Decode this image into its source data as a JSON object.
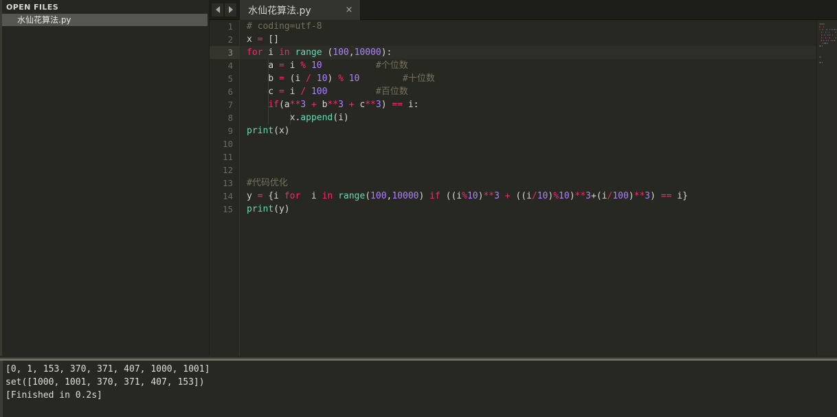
{
  "sidebar": {
    "header": "OPEN FILES",
    "items": [
      {
        "label": "水仙花算法.py",
        "selected": true
      }
    ]
  },
  "tabbar": {
    "nav_prev_icon": "triangle-left-icon",
    "nav_next_icon": "triangle-right-icon",
    "tabs": [
      {
        "label": "水仙花算法.py",
        "close_label": "×",
        "active": true
      }
    ]
  },
  "editor": {
    "active_line": 3,
    "line_numbers": [
      "1",
      "2",
      "3",
      "4",
      "5",
      "6",
      "7",
      "8",
      "9",
      "10",
      "11",
      "12",
      "13",
      "14",
      "15"
    ],
    "lines": [
      {
        "n": 1,
        "tokens": [
          {
            "t": "# coding=utf-8",
            "c": "t-comment"
          }
        ]
      },
      {
        "n": 2,
        "tokens": [
          {
            "t": "x ",
            "c": "t-ident"
          },
          {
            "t": "=",
            "c": "t-op"
          },
          {
            "t": " []",
            "c": "t-punct"
          }
        ]
      },
      {
        "n": 3,
        "tokens": [
          {
            "t": "for",
            "c": "t-keyword"
          },
          {
            "t": " i ",
            "c": "t-ident"
          },
          {
            "t": "in",
            "c": "t-keyword"
          },
          {
            "t": " ",
            "c": "t-plain"
          },
          {
            "t": "range",
            "c": "t-func"
          },
          {
            "t": " (",
            "c": "t-punct"
          },
          {
            "t": "100",
            "c": "t-number"
          },
          {
            "t": ",",
            "c": "t-punct"
          },
          {
            "t": "10000",
            "c": "t-number"
          },
          {
            "t": "):",
            "c": "t-punct"
          }
        ]
      },
      {
        "n": 4,
        "tokens": [
          {
            "t": "    a ",
            "c": "t-ident"
          },
          {
            "t": "=",
            "c": "t-op"
          },
          {
            "t": " i ",
            "c": "t-ident"
          },
          {
            "t": "%",
            "c": "t-op"
          },
          {
            "t": " ",
            "c": "t-plain"
          },
          {
            "t": "10",
            "c": "t-number"
          },
          {
            "t": "          ",
            "c": "t-plain"
          },
          {
            "t": "#个位数",
            "c": "t-comment"
          }
        ]
      },
      {
        "n": 5,
        "tokens": [
          {
            "t": "    b ",
            "c": "t-ident"
          },
          {
            "t": "=",
            "c": "t-op"
          },
          {
            "t": " (i ",
            "c": "t-punct"
          },
          {
            "t": "/",
            "c": "t-op"
          },
          {
            "t": " ",
            "c": "t-plain"
          },
          {
            "t": "10",
            "c": "t-number"
          },
          {
            "t": ") ",
            "c": "t-punct"
          },
          {
            "t": "%",
            "c": "t-op"
          },
          {
            "t": " ",
            "c": "t-plain"
          },
          {
            "t": "10",
            "c": "t-number"
          },
          {
            "t": "        ",
            "c": "t-plain"
          },
          {
            "t": "#十位数",
            "c": "t-comment"
          }
        ]
      },
      {
        "n": 6,
        "tokens": [
          {
            "t": "    c ",
            "c": "t-ident"
          },
          {
            "t": "=",
            "c": "t-op"
          },
          {
            "t": " i ",
            "c": "t-ident"
          },
          {
            "t": "/",
            "c": "t-op"
          },
          {
            "t": " ",
            "c": "t-plain"
          },
          {
            "t": "100",
            "c": "t-number"
          },
          {
            "t": "         ",
            "c": "t-plain"
          },
          {
            "t": "#百位数",
            "c": "t-comment"
          }
        ]
      },
      {
        "n": 7,
        "tokens": [
          {
            "t": "    ",
            "c": "t-plain"
          },
          {
            "t": "if",
            "c": "t-keyword"
          },
          {
            "t": "(a",
            "c": "t-punct"
          },
          {
            "t": "**",
            "c": "t-op"
          },
          {
            "t": "3",
            "c": "t-number"
          },
          {
            "t": " ",
            "c": "t-plain"
          },
          {
            "t": "+",
            "c": "t-op"
          },
          {
            "t": " b",
            "c": "t-ident"
          },
          {
            "t": "**",
            "c": "t-op"
          },
          {
            "t": "3",
            "c": "t-number"
          },
          {
            "t": " ",
            "c": "t-plain"
          },
          {
            "t": "+",
            "c": "t-op"
          },
          {
            "t": " c",
            "c": "t-ident"
          },
          {
            "t": "**",
            "c": "t-op"
          },
          {
            "t": "3",
            "c": "t-number"
          },
          {
            "t": ") ",
            "c": "t-punct"
          },
          {
            "t": "==",
            "c": "t-op"
          },
          {
            "t": " i:",
            "c": "t-punct"
          }
        ]
      },
      {
        "n": 8,
        "tokens": [
          {
            "t": "        x.",
            "c": "t-punct"
          },
          {
            "t": "append",
            "c": "t-func"
          },
          {
            "t": "(i)",
            "c": "t-punct"
          }
        ]
      },
      {
        "n": 9,
        "tokens": [
          {
            "t": "print",
            "c": "t-func"
          },
          {
            "t": "(x)",
            "c": "t-punct"
          }
        ]
      },
      {
        "n": 10,
        "tokens": []
      },
      {
        "n": 11,
        "tokens": []
      },
      {
        "n": 12,
        "tokens": []
      },
      {
        "n": 13,
        "tokens": [
          {
            "t": "#代码优化",
            "c": "t-comment"
          }
        ]
      },
      {
        "n": 14,
        "tokens": [
          {
            "t": "y ",
            "c": "t-ident"
          },
          {
            "t": "=",
            "c": "t-op"
          },
          {
            "t": " {i ",
            "c": "t-punct"
          },
          {
            "t": "for",
            "c": "t-keyword"
          },
          {
            "t": "  i ",
            "c": "t-ident"
          },
          {
            "t": "in",
            "c": "t-keyword"
          },
          {
            "t": " ",
            "c": "t-plain"
          },
          {
            "t": "range",
            "c": "t-func"
          },
          {
            "t": "(",
            "c": "t-punct"
          },
          {
            "t": "100",
            "c": "t-number"
          },
          {
            "t": ",",
            "c": "t-punct"
          },
          {
            "t": "10000",
            "c": "t-number"
          },
          {
            "t": ") ",
            "c": "t-punct"
          },
          {
            "t": "if",
            "c": "t-keyword"
          },
          {
            "t": " ((i",
            "c": "t-punct"
          },
          {
            "t": "%",
            "c": "t-op"
          },
          {
            "t": "10",
            "c": "t-number"
          },
          {
            "t": ")",
            "c": "t-punct"
          },
          {
            "t": "**",
            "c": "t-op"
          },
          {
            "t": "3",
            "c": "t-number"
          },
          {
            "t": " ",
            "c": "t-plain"
          },
          {
            "t": "+",
            "c": "t-op"
          },
          {
            "t": " ((i",
            "c": "t-punct"
          },
          {
            "t": "/",
            "c": "t-op"
          },
          {
            "t": "10",
            "c": "t-number"
          },
          {
            "t": ")",
            "c": "t-punct"
          },
          {
            "t": "%",
            "c": "t-op"
          },
          {
            "t": "10",
            "c": "t-number"
          },
          {
            "t": ")",
            "c": "t-punct"
          },
          {
            "t": "**",
            "c": "t-op"
          },
          {
            "t": "3",
            "c": "t-number"
          },
          {
            "t": "+(i",
            "c": "t-punct"
          },
          {
            "t": "/",
            "c": "t-op"
          },
          {
            "t": "100",
            "c": "t-number"
          },
          {
            "t": ")",
            "c": "t-punct"
          },
          {
            "t": "**",
            "c": "t-op"
          },
          {
            "t": "3",
            "c": "t-number"
          },
          {
            "t": ") ",
            "c": "t-punct"
          },
          {
            "t": "==",
            "c": "t-op"
          },
          {
            "t": " i}",
            "c": "t-punct"
          }
        ]
      },
      {
        "n": 15,
        "tokens": [
          {
            "t": "print",
            "c": "t-func"
          },
          {
            "t": "(y)",
            "c": "t-punct"
          }
        ]
      }
    ]
  },
  "console": {
    "lines": [
      "[0, 1, 153, 370, 371, 407, 1000, 1001]",
      "set([1000, 1001, 370, 371, 407, 153])",
      "[Finished in 0.2s]"
    ]
  },
  "colors": {
    "editor_bg": "#272822",
    "sidebar_bg": "#262722",
    "tabbar_bg": "#1d1e19",
    "tab_active_bg": "#33342d",
    "keyword": "#f92672",
    "function": "#66d9b8",
    "number": "#ae81ff",
    "comment": "#75715e",
    "text": "#d8d8d2",
    "selection": "#55564f"
  }
}
